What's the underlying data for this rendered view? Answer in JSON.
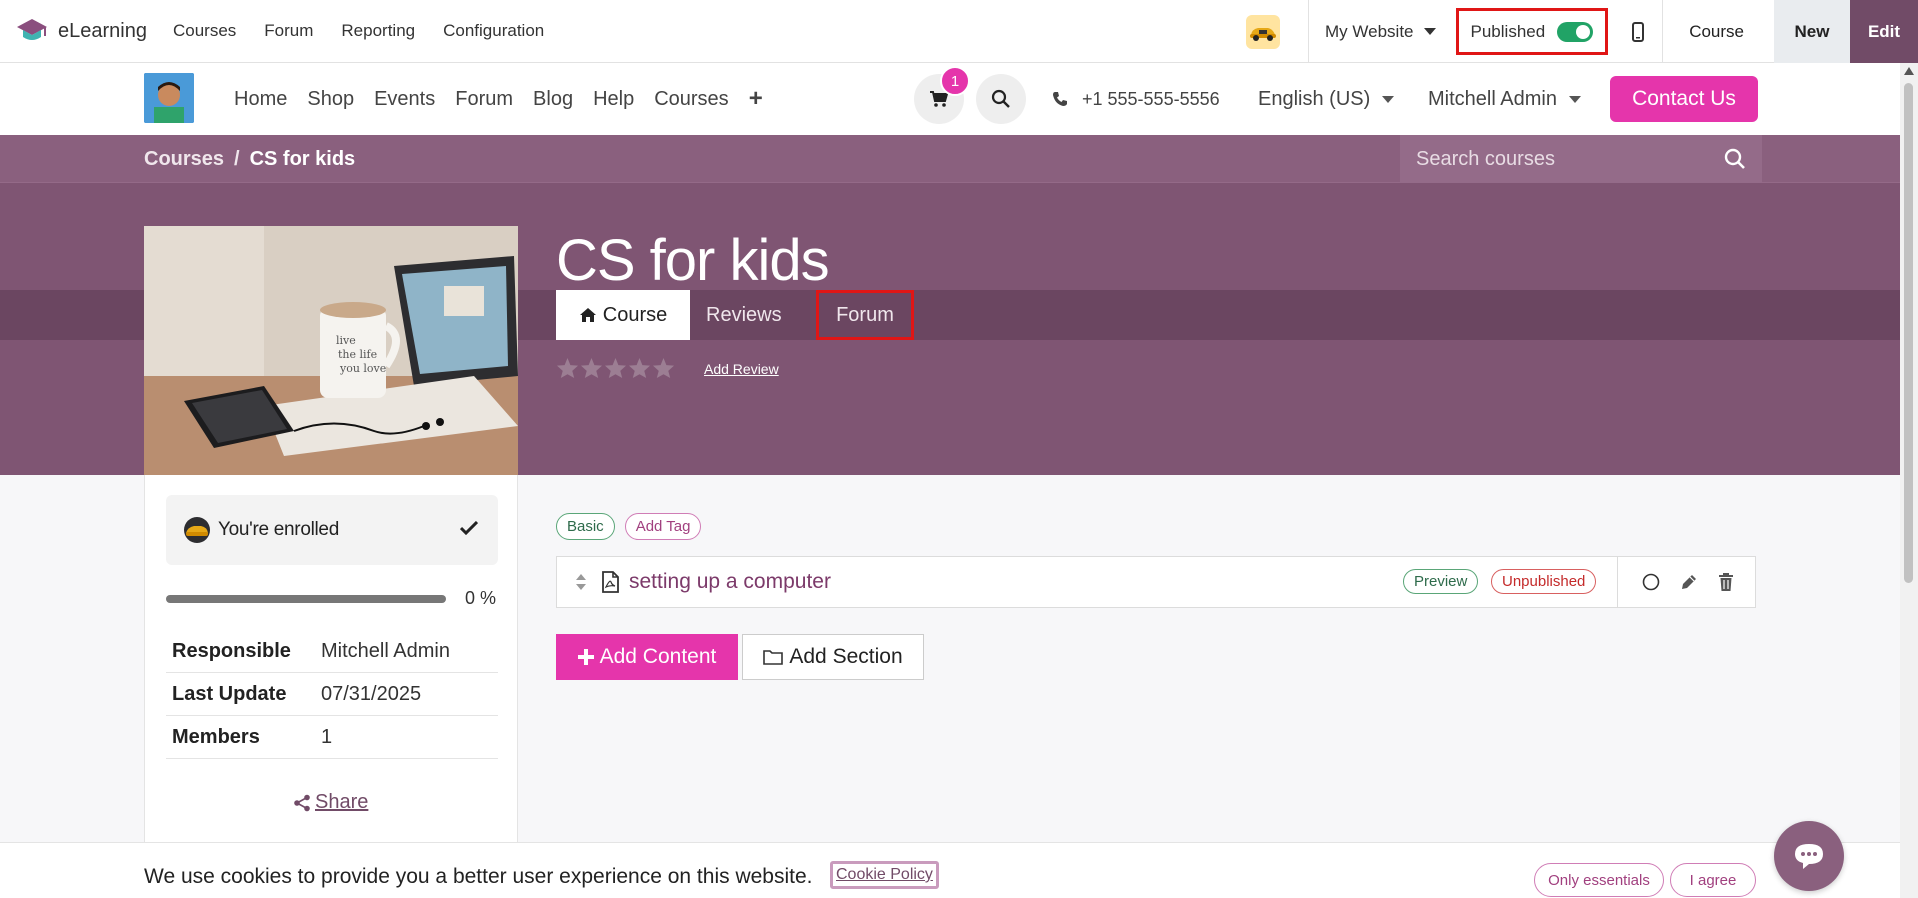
{
  "admin": {
    "app_name": "eLearning",
    "menu": [
      "Courses",
      "Forum",
      "Reporting",
      "Configuration"
    ],
    "my_website": "My Website",
    "published_label": "Published",
    "course_label": "Course",
    "new_label": "New",
    "edit_label": "Edit"
  },
  "site_nav": {
    "links": [
      "Home",
      "Shop",
      "Events",
      "Forum",
      "Blog",
      "Help",
      "Courses",
      "+"
    ],
    "cart_count": "1",
    "phone": "+1 555-555-5556",
    "language": "English (US)",
    "user": "Mitchell Admin",
    "contact_label": "Contact Us"
  },
  "breadcrumb": {
    "parent": "Courses",
    "separator": "/",
    "current": "CS for kids"
  },
  "search": {
    "placeholder": "Search courses"
  },
  "course": {
    "title": "CS for kids",
    "add_review": "Add Review",
    "rating_stars": 5,
    "rating_filled": 0
  },
  "tabs": [
    {
      "label": "Course",
      "active": true
    },
    {
      "label": "Reviews",
      "active": false
    },
    {
      "label": "Forum",
      "active": false
    }
  ],
  "sidebar": {
    "enrolled_text": "You're enrolled",
    "progress_percent": 0,
    "progress_label": "0 %",
    "info": [
      {
        "key": "Responsible",
        "value": "Mitchell Admin"
      },
      {
        "key": "Last Update",
        "value": "07/31/2025"
      },
      {
        "key": "Members",
        "value": "1"
      }
    ],
    "share_label": " Share"
  },
  "content": {
    "tags": [
      "Basic",
      "Add Tag"
    ],
    "item_name": "setting up a computer",
    "preview_badge": "Preview",
    "unpublished_badge": "Unpublished",
    "add_content_label": "Add Content",
    "add_section_label": "Add Section"
  },
  "cookie": {
    "message": "We use cookies to provide you a better user experience on this website.",
    "policy_label": "Cookie Policy",
    "only_essentials": "Only essentials",
    "agree": "I agree"
  },
  "colors": {
    "brand": "#714b67",
    "accent": "#e535ab",
    "hero": "#7f5573",
    "highlight": "#e01616"
  }
}
